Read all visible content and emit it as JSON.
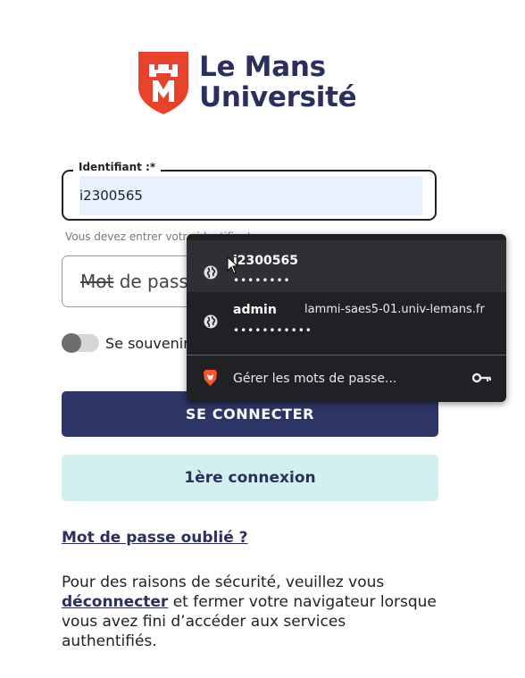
{
  "logo": {
    "line1": "Le Mans",
    "line2": "Université",
    "brand_color": "#e8412c",
    "text_color": "#2b2f5e"
  },
  "login_form": {
    "identifiant_label": "Identifiant :*",
    "identifiant_value": "i2300565",
    "identifiant_hint": "Vous devez entrer votre identifiant",
    "password_placeholder_strike": "Mot",
    "password_placeholder_rest": " de passe",
    "remember_label": "Se souvenir de moi",
    "connect_button": "SE CONNECTER",
    "first_login_button": "1ère connexion",
    "forgot_link": "Mot de passe oublié ?",
    "security_text_before": "Pour des raisons de sécurité, veuillez vous ",
    "security_link": "déconnecter",
    "security_text_after": " et fermer votre navigateur lorsque vous avez fini d’accéder aux services authentifiés."
  },
  "autofill_popup": {
    "entries": [
      {
        "username": "i2300565",
        "password_mask": "••••••••",
        "site": "",
        "icon": "globe-icon"
      },
      {
        "username": "admin",
        "password_mask": "•••••••••••",
        "site": "lammi-saes5-01.univ-lemans.fr",
        "icon": "globe-icon"
      }
    ],
    "manage_label": "Gérer les mots de passe...",
    "manage_icon": "brave-lion-icon",
    "key_icon": "key-icon"
  },
  "colors": {
    "primary_button": "#2d3466",
    "secondary_button": "#d4eff0",
    "autofill_bg": "#e8f0fe",
    "popup_bg": "#202124"
  }
}
